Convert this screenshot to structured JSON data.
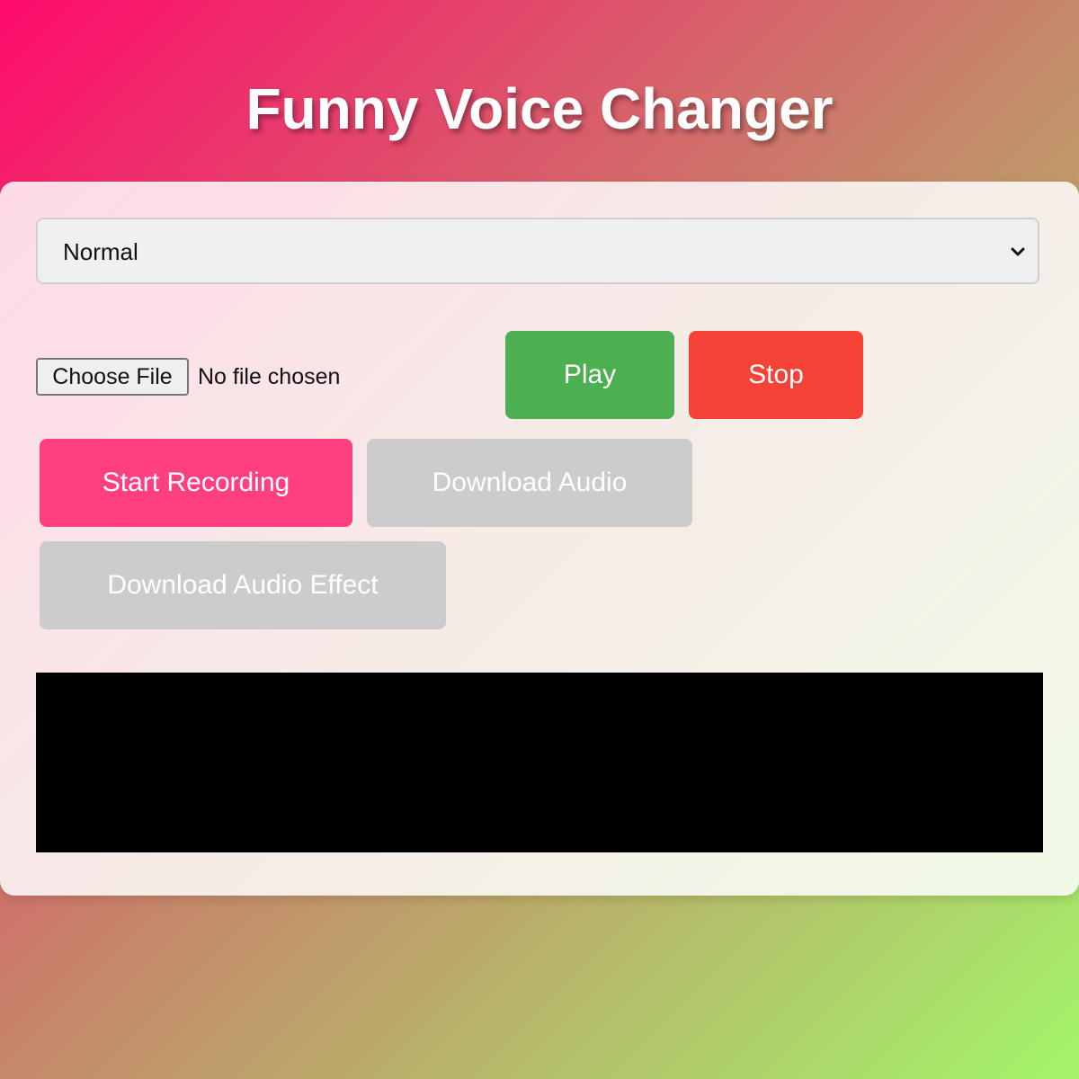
{
  "app": {
    "title": "Funny Voice Changer"
  },
  "effect_select": {
    "selected": "Normal",
    "icon": "chevron-down-icon"
  },
  "file_input": {
    "button_label": "Choose File",
    "status": "No file chosen"
  },
  "controls": {
    "play_label": "Play",
    "stop_label": "Stop",
    "record_label": "Start Recording",
    "download_label": "Download Audio",
    "download_effect_label": "Download Audio Effect"
  },
  "colors": {
    "play": "#4caf50",
    "stop": "#f44336",
    "record": "#ff3f80",
    "disabled": "#cccccc",
    "visualizer": "#000000"
  }
}
